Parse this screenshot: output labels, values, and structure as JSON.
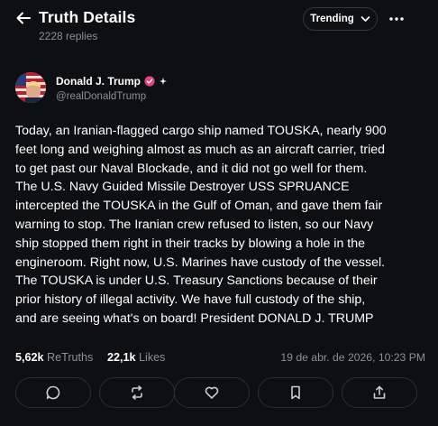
{
  "header": {
    "title": "Truth Details",
    "replies": "2228 replies",
    "sort_label": "Trending"
  },
  "author": {
    "name": "Donald J. Trump",
    "handle": "@realDonaldTrump"
  },
  "post": {
    "body": "Today, an Iranian-flagged cargo ship named TOUSKA, nearly 900\nfeet long and weighing almost as much as an aircraft carrier, tried\nto get past our Naval Blockade, and it did not go well for them.\nThe U.S. Navy Guided Missile Destroyer USS SPRUANCE\nintercepted the TOUSKA in the Gulf of Oman, and gave them fair\nwarning to stop. The Iranian crew refused to listen, so our Navy\nship stopped them right in their tracks by blowing a hole in the\nengineroom. Right now, U.S. Marines have custody of the vessel.\nThe TOUSKA is under U.S. Treasury Sanctions because of their\nprior history of illegal activity. We have full custody of the ship,\nand are seeing what's on board! President DONALD J. TRUMP"
  },
  "stats": {
    "retruths_count": "5,62k",
    "retruths_label": "ReTruths",
    "likes_count": "22,1k",
    "likes_label": "Likes",
    "timestamp": "19 de abr. de 2026, 10:23 PM"
  },
  "colors": {
    "background": "#0e0f14",
    "muted_text": "#8b8f9c",
    "verified_badge": "#e0457b",
    "border": "#2c2e36"
  },
  "icons": {
    "back": "arrow-left-icon",
    "sort_dropdown": "chevron-down-icon",
    "more": "more-horizontal-icon",
    "verified": "verified-badge-icon",
    "reply": "comment-icon",
    "retruth": "repost-icon",
    "like": "heart-icon",
    "bookmark": "bookmark-icon",
    "share": "share-icon"
  }
}
